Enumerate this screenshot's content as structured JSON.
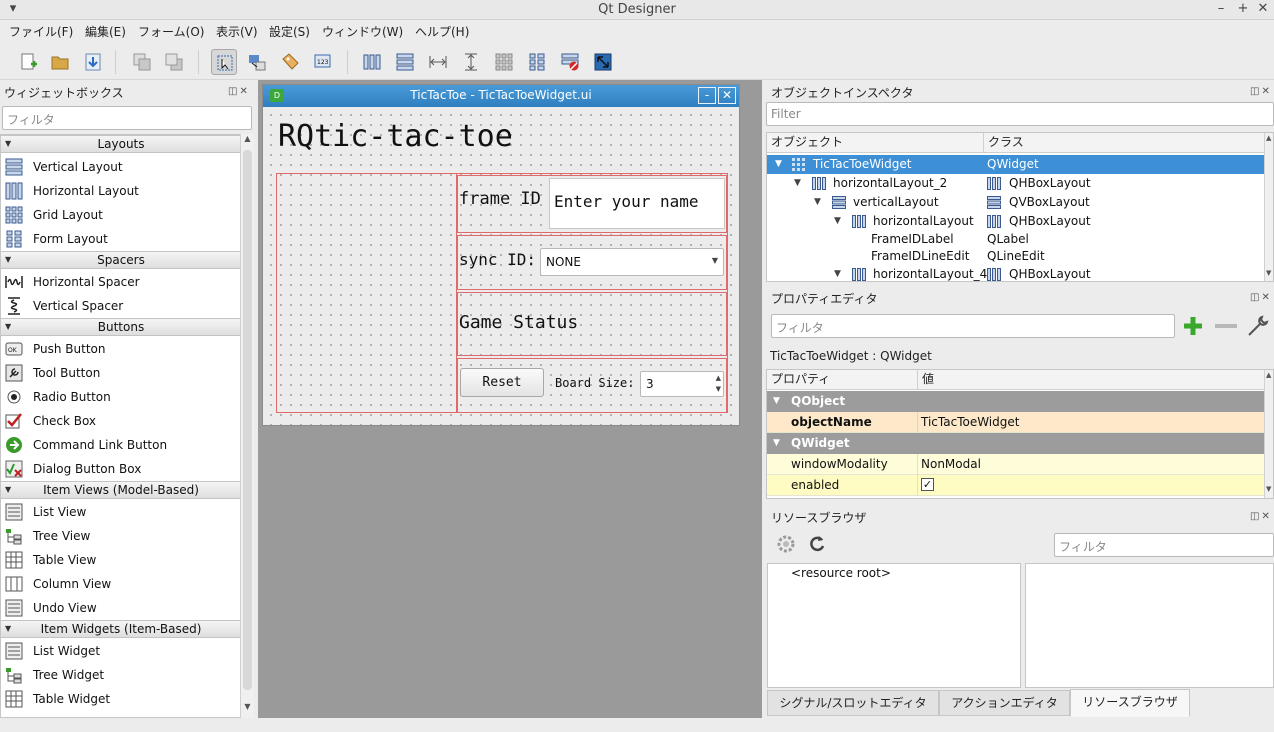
{
  "window": {
    "title": "Qt Designer"
  },
  "menu": [
    "ファイル(F)",
    "編集(E)",
    "フォーム(O)",
    "表示(V)",
    "設定(S)",
    "ウィンドウ(W)",
    "ヘルプ(H)"
  ],
  "widget_box": {
    "title": "ウィジェットボックス",
    "filter_placeholder": "フィルタ",
    "categories": [
      {
        "name": "Layouts",
        "items": [
          "Vertical Layout",
          "Horizontal Layout",
          "Grid Layout",
          "Form Layout"
        ]
      },
      {
        "name": "Spacers",
        "items": [
          "Horizontal Spacer",
          "Vertical Spacer"
        ]
      },
      {
        "name": "Buttons",
        "items": [
          "Push Button",
          "Tool Button",
          "Radio Button",
          "Check Box",
          "Command Link Button",
          "Dialog Button Box"
        ]
      },
      {
        "name": "Item Views (Model-Based)",
        "items": [
          "List View",
          "Tree View",
          "Table View",
          "Column View",
          "Undo View"
        ]
      },
      {
        "name": "Item Widgets (Item-Based)",
        "items": [
          "List Widget",
          "Tree Widget",
          "Table Widget"
        ]
      }
    ]
  },
  "form": {
    "title": "TicTacToe - TicTacToeWidget.ui",
    "minimize": "-",
    "close": "✕",
    "heading": "RQtic-tac-toe",
    "frame_id_label": "frame ID",
    "name_placeholder": "Enter your name",
    "sync_id_label": "sync ID:",
    "sync_value": "NONE",
    "game_status": "Game Status",
    "reset_label": "Reset",
    "board_size_label": "Board Size:",
    "board_size_value": "3"
  },
  "object_inspector": {
    "title": "オブジェクトインスペクタ",
    "filter_placeholder": "Filter",
    "col_object": "オブジェクト",
    "col_class": "クラス",
    "rows": [
      {
        "name": "TicTacToeWidget",
        "cls": "QWidget"
      },
      {
        "name": "horizontalLayout_2",
        "cls": "QHBoxLayout"
      },
      {
        "name": "verticalLayout",
        "cls": "QVBoxLayout"
      },
      {
        "name": "horizontalLayout",
        "cls": "QHBoxLayout"
      },
      {
        "name": "FrameIDLabel",
        "cls": "QLabel"
      },
      {
        "name": "FrameIDLineEdit",
        "cls": "QLineEdit"
      },
      {
        "name": "horizontalLayout_4",
        "cls": "QHBoxLayout"
      }
    ]
  },
  "property_editor": {
    "title": "プロパティエディタ",
    "filter_placeholder": "フィルタ",
    "context": "TicTacToeWidget : QWidget",
    "col_property": "プロパティ",
    "col_value": "値",
    "group_qobject": "QObject",
    "object_name_key": "objectName",
    "object_name_value": "TicTacToeWidget",
    "group_qwidget": "QWidget",
    "window_modality_key": "windowModality",
    "window_modality_value": "NonModal",
    "enabled_key": "enabled",
    "enabled_value": "✓"
  },
  "resource_browser": {
    "title": "リソースブラウザ",
    "filter_placeholder": "フィルタ",
    "root": "<resource root>"
  },
  "bottom_tabs": [
    "シグナル/スロットエディタ",
    "アクションエディタ",
    "リソースブラウザ"
  ]
}
